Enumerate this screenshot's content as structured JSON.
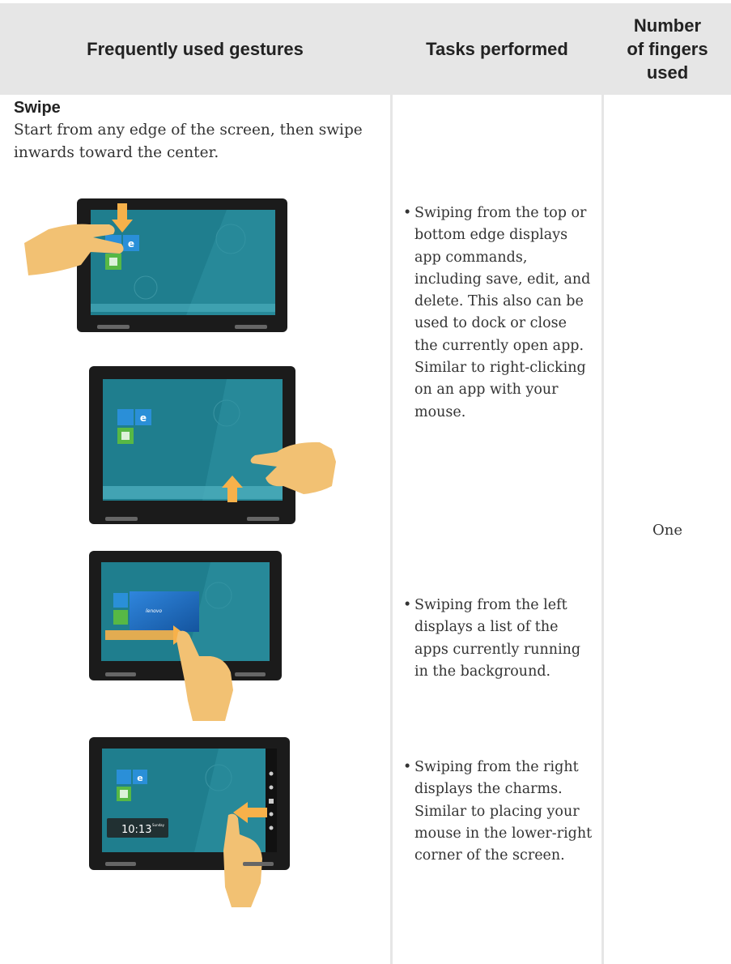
{
  "header": {
    "gestures": "Frequently used gestures",
    "tasks": "Tasks performed",
    "fingers_line1": "Number",
    "fingers_line2": "of fingers",
    "fingers_line3": "used"
  },
  "gesture": {
    "title": "Swipe",
    "description": "Start from any edge of the screen, then swipe inwards toward the center."
  },
  "tasks": [
    {
      "bullet": "•",
      "text": "Swiping from the top or bottom edge displays app commands, including save, edit, and delete. This also can be used to dock or close the currently open app. Similar to right-clicking on an app with your mouse."
    },
    {
      "bullet": "•",
      "text": "Swiping from the left displays a list of the apps currently running in the background."
    },
    {
      "bullet": "•",
      "text": "Swiping from the right displays the charms. Similar to placing your mouse in the lower-right corner of the screen."
    }
  ],
  "fingers_used": "One",
  "illustrations": [
    {
      "icon": "tablet-swipe-top-illustration"
    },
    {
      "icon": "tablet-swipe-bottom-illustration"
    },
    {
      "icon": "tablet-swipe-left-illustration",
      "card_label": "lenovo"
    },
    {
      "icon": "tablet-swipe-right-illustration",
      "clock_time": "10:13",
      "clock_day": "Sunday"
    }
  ],
  "colors": {
    "header_bg": "#e6e6e6",
    "screen": "#1f7e8e",
    "hand": "#f2c173",
    "arrow": "#f7b14a",
    "tile_blue": "#2a8fd8",
    "tile_green": "#57b845"
  }
}
